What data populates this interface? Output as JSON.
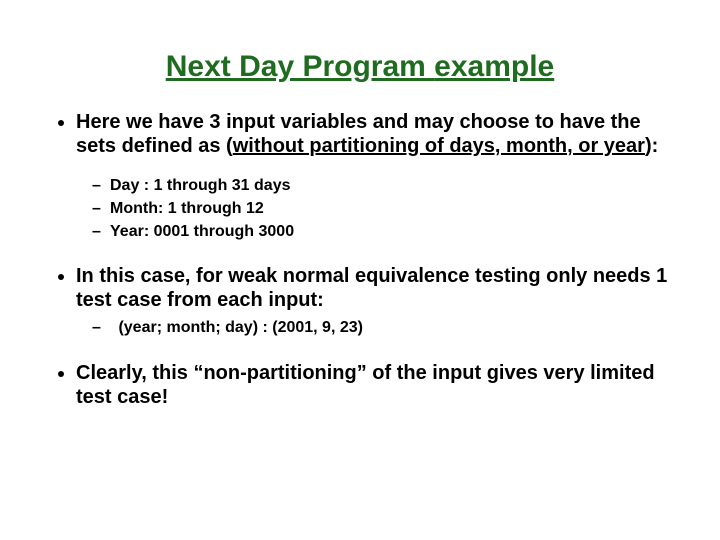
{
  "title": {
    "part1": "Next Day Program ",
    "part2": "example"
  },
  "bullets": {
    "b1": {
      "pre": "Here we have 3 input variables and may choose to have the sets defined as (",
      "under": "without partitioning of days, month, or year",
      "post": "):",
      "subs": {
        "s1": "Day : 1 through 31 days",
        "s2": "Month: 1 through 12",
        "s3": "Year: 0001 through 3000"
      }
    },
    "b2": {
      "text": "In this case, for weak normal equivalence testing only needs 1 test case from each input:",
      "sub": " (year; month; day) :  (2001, 9, 23)"
    },
    "b3": {
      "text": "Clearly, this “non-partitioning” of the input gives very limited test case!"
    }
  }
}
